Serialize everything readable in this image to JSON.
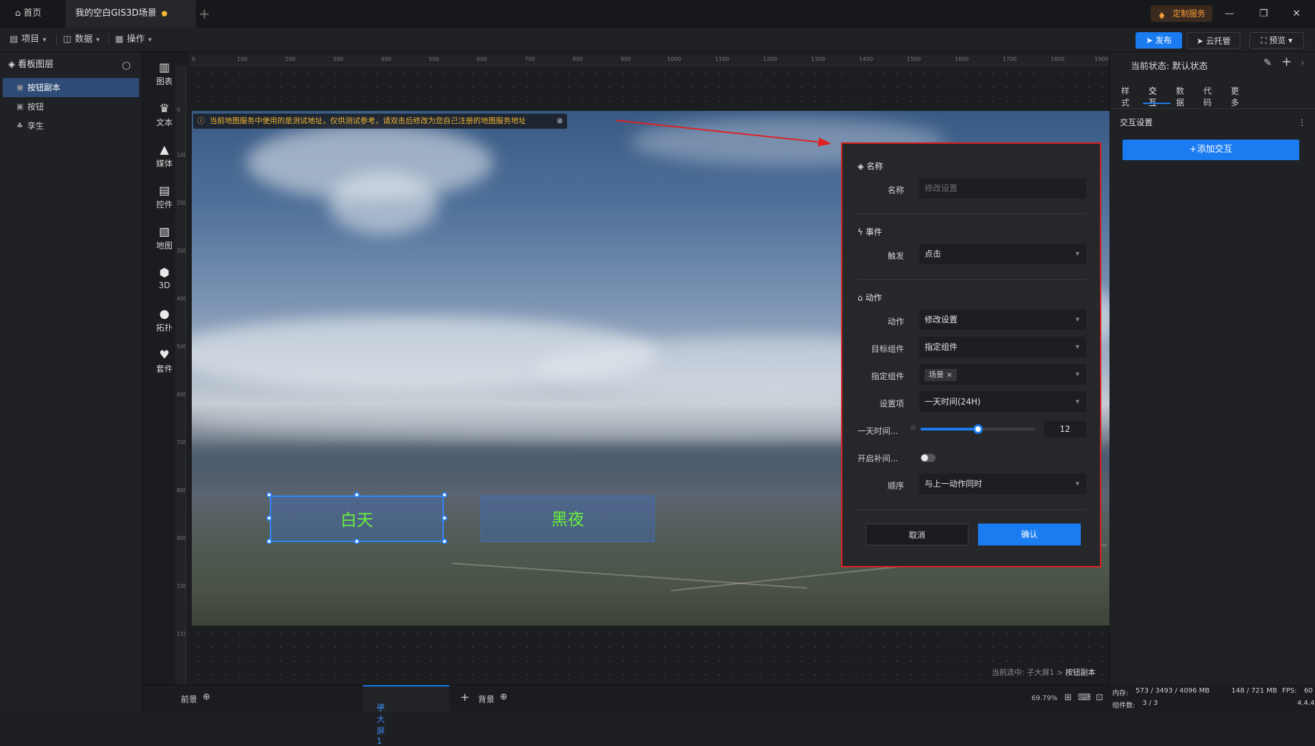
{
  "titlebar": {
    "tabs": [
      {
        "label": "首页",
        "icon": "home-icon"
      },
      {
        "label": "我的空白GIS3D场景",
        "icon": "unsaved-dot"
      }
    ],
    "custom_service": "定制服务",
    "window_controls": [
      "minimize",
      "restore",
      "close"
    ]
  },
  "toolbar": {
    "menus": [
      {
        "label": "项目",
        "icon": "document-icon"
      },
      {
        "label": "数据",
        "icon": "database-icon"
      },
      {
        "label": "操作",
        "icon": "grid-icon"
      }
    ],
    "publish": "发布",
    "cloud": "云托管",
    "preview": "预览"
  },
  "layers": {
    "title": "看板图层",
    "items": [
      {
        "label": "按钮副本",
        "icon": "image-icon",
        "selected": true
      },
      {
        "label": "按钮",
        "icon": "image-icon",
        "selected": false
      },
      {
        "label": "孪生",
        "icon": "twin-icon",
        "selected": false
      }
    ]
  },
  "components": [
    {
      "label": "图表",
      "icon": "chart-icon"
    },
    {
      "label": "文本",
      "icon": "text-icon"
    },
    {
      "label": "媒体",
      "icon": "media-icon"
    },
    {
      "label": "控件",
      "icon": "control-icon"
    },
    {
      "label": "地图",
      "icon": "map-icon"
    },
    {
      "label": "3D",
      "icon": "cube-icon"
    },
    {
      "label": "拓扑",
      "icon": "topology-icon"
    },
    {
      "label": "套件",
      "icon": "suite-icon"
    }
  ],
  "ruler": {
    "top_ticks": [
      "0",
      "100",
      "200",
      "300",
      "400",
      "500",
      "600",
      "700",
      "800",
      "900",
      "1000",
      "1100",
      "1200",
      "1300",
      "1400",
      "1500",
      "1600",
      "1700",
      "1800",
      "1900"
    ],
    "left_ticks": [
      "0",
      "100",
      "200",
      "300",
      "400",
      "500",
      "600",
      "700",
      "800",
      "900",
      "1000",
      "1100"
    ]
  },
  "canvas": {
    "warning": "当前地图服务中使用的是测试地址，仅供测试参考，请双击后修改为您自己注册的地图服务地址",
    "day_button": "白天",
    "night_button": "黑夜",
    "selection_path_prefix": "当前选中: 子大屏1 > ",
    "selection_path_current": "按钮副本"
  },
  "dialog": {
    "section_name": "名称",
    "name_label": "名称",
    "name_placeholder": "修改设置",
    "section_event": "事件",
    "trigger_label": "触发",
    "trigger_value": "点击",
    "section_action": "动作",
    "action_label": "动作",
    "action_value": "修改设置",
    "target_label": "目标组件",
    "target_value": "指定组件",
    "specified_label": "指定组件",
    "specified_tag": "场景",
    "setting_label": "设置项",
    "setting_value": "一天时间(24H)",
    "time_label": "一天时间...",
    "time_value": "12",
    "time_max": 24,
    "tween_label": "开启补间...",
    "tween_on": false,
    "order_label": "顺序",
    "order_value": "与上一动作同时",
    "cancel": "取消",
    "confirm": "确认"
  },
  "right_panel": {
    "state_label": "当前状态: ",
    "state_value": "默认状态",
    "tabs": [
      "样式",
      "交互",
      "数据",
      "代码",
      "更多"
    ],
    "active_tab": "交互",
    "section": "交互设置",
    "add_button": "+添加交互"
  },
  "bottom": {
    "foreground": "前景",
    "screen": "子大屏1",
    "background": "背景",
    "zoom": "69.79%"
  },
  "status": {
    "memory_label": "内存:",
    "memory_value": "573 / 3493 / 4096 MB",
    "memory_extra": "148 / 721 MB",
    "fps_label": "FPS:",
    "fps_value": "60",
    "components_label": "组件数:",
    "components_value": "3 / 3",
    "version": "4.4.4"
  },
  "colors": {
    "accent": "#1a7cf0",
    "warning": "#f2b431",
    "highlight_border": "#e02020",
    "button_text": "#68f23b"
  }
}
